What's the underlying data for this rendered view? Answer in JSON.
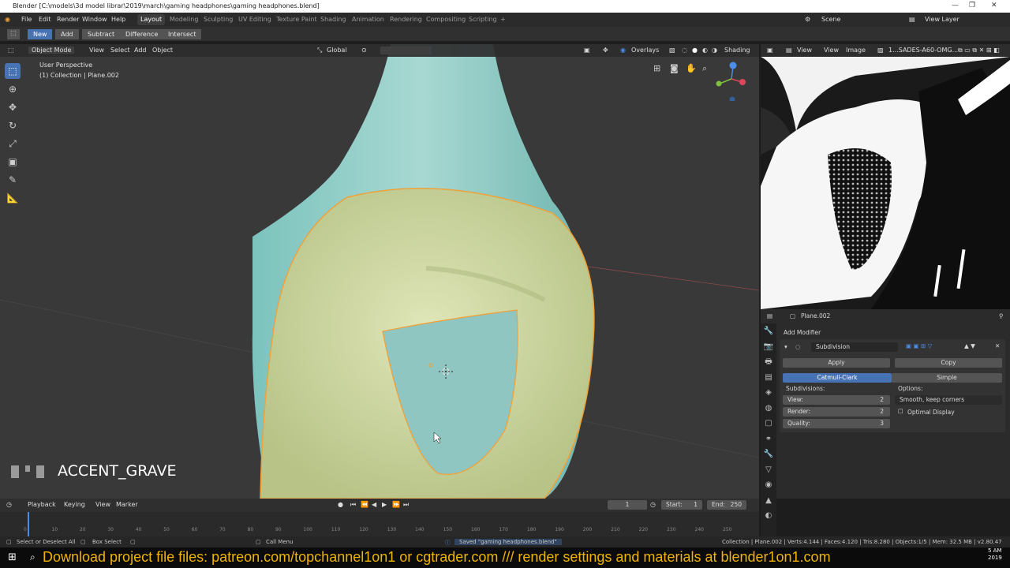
{
  "window": {
    "title": "Blender [C:\\models\\3d model librar\\2019\\march\\gaming headphones\\gaming headphones.blend]",
    "minimize": "—",
    "maximize": "❐",
    "close": "✕"
  },
  "menu": {
    "file": "File",
    "edit": "Edit",
    "render": "Render",
    "window": "Window",
    "help": "Help"
  },
  "workspaces": [
    "Layout",
    "Modeling",
    "Sculpting",
    "UV Editing",
    "Texture Paint",
    "Shading",
    "Animation",
    "Rendering",
    "Compositing",
    "Scripting",
    "+"
  ],
  "scene": {
    "scene": "Scene",
    "view_layer": "View Layer"
  },
  "toolbar": {
    "new": "New",
    "add": "Add",
    "subtract": "Subtract",
    "difference": "Difference",
    "intersect": "Intersect"
  },
  "viewport_header": {
    "mode": "Object Mode",
    "view": "View",
    "select": "Select",
    "add": "Add",
    "object": "Object",
    "orientation": "Global",
    "overlays": "Overlays",
    "shading": "Shading"
  },
  "viewport_info": {
    "perspective": "User Perspective",
    "collection": "(1) Collection | Plane.002"
  },
  "key_overlay": "ACCENT_GRAVE",
  "image_editor": {
    "view": "View",
    "view2": "View",
    "image": "Image",
    "image_name": "1...SADES-A60-OMG..."
  },
  "properties": {
    "object": "Plane.002",
    "add_modifier": "Add Modifier",
    "modifier_name": "Subdivision",
    "apply": "Apply",
    "copy": "Copy",
    "catmull": "Catmull-Clark",
    "simple": "Simple",
    "subdivisions_label": "Subdivisions:",
    "options_label": "Options:",
    "view_label": "View:",
    "view_value": "2",
    "render_label": "Render:",
    "render_value": "2",
    "quality_label": "Quality:",
    "quality_value": "3",
    "uv_option": "Smooth, keep corners",
    "optimal_display": "Optimal Display"
  },
  "timeline": {
    "playback": "Playback",
    "keying": "Keying",
    "view": "View",
    "marker": "Marker",
    "current": "1",
    "start_label": "Start:",
    "start": "1",
    "end_label": "End:",
    "end": "250",
    "ticks": [
      "0",
      "10",
      "20",
      "30",
      "40",
      "50",
      "60",
      "70",
      "80",
      "90",
      "100",
      "110",
      "120",
      "130",
      "140",
      "150",
      "160",
      "170",
      "180",
      "190",
      "200",
      "210",
      "220",
      "230",
      "240",
      "250"
    ]
  },
  "status": {
    "select": "Select or Deselect All",
    "box": "Box Select",
    "call_menu": "Call Menu",
    "saved": "Saved \"gaming headphones.blend\"",
    "stats": "Collection | Plane.002 | Verts:4.144 | Faces:4.120 | Tris:8.280 | Objects:1/5 | Mem: 32.5 MB | v2.80.47"
  },
  "clock": {
    "time": "5 AM",
    "year": "2019"
  },
  "banner": "Download project file files: patreon.com/topchannel1on1 or cgtrader.com  /// render settings and materials at blender1on1.com",
  "colors": {
    "accent": "#4772b3",
    "banner_text": "#f1b400",
    "mesh_outer": "#8fc9c3",
    "mesh_yellow": "#c9d69a",
    "outline": "#f0a13a"
  }
}
